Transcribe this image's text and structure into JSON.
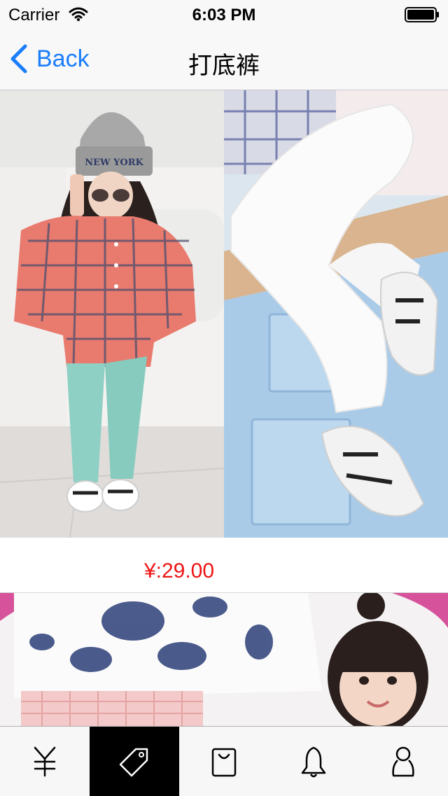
{
  "status_bar": {
    "carrier": "Carrier",
    "time": "6:03 PM"
  },
  "nav": {
    "back_label": "Back",
    "title": "打底裤"
  },
  "products": [
    {
      "image_desc": "girl in plaid shirt, mint leggings and white sneakers; white leggings close-up",
      "price": "¥:29.00"
    },
    {
      "image_desc": "floral blouse and smiling girl (partially visible)"
    }
  ],
  "tab_bar": {
    "tabs": [
      {
        "icon": "yen-icon",
        "active": false
      },
      {
        "icon": "tag-icon",
        "active": true
      },
      {
        "icon": "shopping-bag-icon",
        "active": false
      },
      {
        "icon": "bell-icon",
        "active": false
      },
      {
        "icon": "person-icon",
        "active": false
      }
    ]
  },
  "colors": {
    "accent": "#1a7efb",
    "price": "#ef1414",
    "active_tab": "#000000"
  }
}
